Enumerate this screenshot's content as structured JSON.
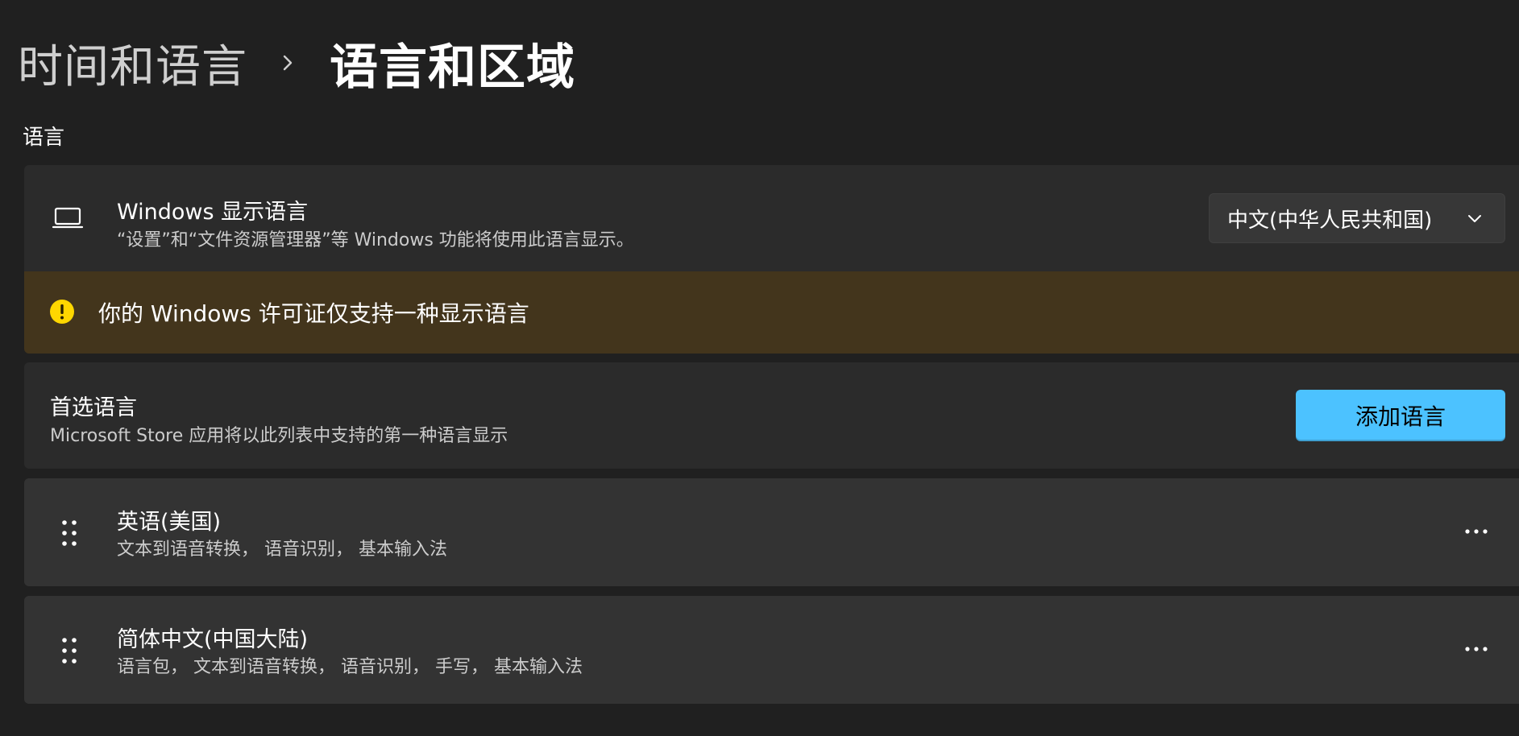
{
  "breadcrumb": {
    "parent": "时间和语言",
    "current": "语言和区域"
  },
  "section_title": "语言",
  "display_language": {
    "title": "Windows 显示语言",
    "description": "“设置”和“文件资源管理器”等 Windows 功能将使用此语言显示。",
    "selected": "中文(中华人民共和国)",
    "icon": "laptop-icon"
  },
  "warning": {
    "text": "你的 Windows 许可证仅支持一种显示语言",
    "icon": "warning-icon",
    "color": "#ffd700"
  },
  "preferred": {
    "title": "首选语言",
    "description": "Microsoft Store 应用将以此列表中支持的第一种语言显示",
    "add_button": "添加语言"
  },
  "languages": [
    {
      "name": "英语(美国)",
      "features": "文本到语音转换， 语音识别， 基本输入法"
    },
    {
      "name": "简体中文(中国大陆)",
      "features": "语言包， 文本到语音转换， 语音识别， 手写， 基本输入法"
    }
  ],
  "colors": {
    "background": "#202020",
    "card": "#2b2b2b",
    "warning_bg": "#43351c",
    "accent": "#4cc2ff"
  }
}
